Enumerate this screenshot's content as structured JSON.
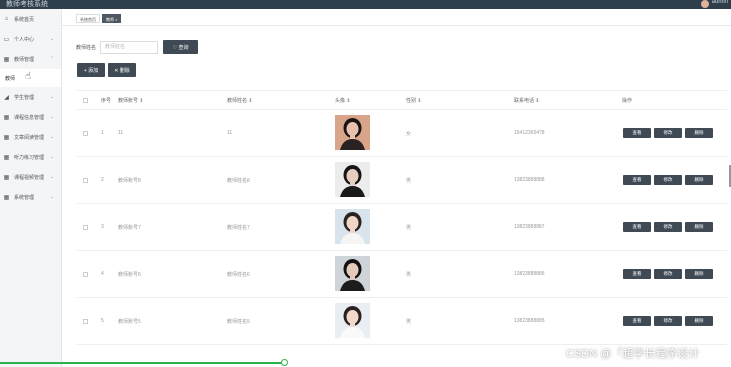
{
  "topbar": {
    "title": "教师考核系统",
    "user": "admin"
  },
  "sidebar": {
    "items": [
      {
        "label": "系统首页",
        "icon": "home-icon",
        "glyph": "⌂"
      },
      {
        "label": "个人中心",
        "icon": "calendar-icon",
        "glyph": "▭"
      },
      {
        "label": "教师管理",
        "icon": "grid-icon",
        "glyph": "▦"
      },
      {
        "label": "学生管理",
        "icon": "trend-icon",
        "glyph": "◢"
      },
      {
        "label": "课程信息管理",
        "icon": "grid-icon",
        "glyph": "▦"
      },
      {
        "label": "文章阅读管理",
        "icon": "grid-icon",
        "glyph": "▦"
      },
      {
        "label": "听力练习管理",
        "icon": "grid-icon",
        "glyph": "▦"
      },
      {
        "label": "课程视频管理",
        "icon": "grid-icon",
        "glyph": "▦"
      },
      {
        "label": "系统管理",
        "icon": "grid-icon",
        "glyph": "▦"
      }
    ],
    "sub_item": "教师"
  },
  "tabs": [
    {
      "label": "系统首页"
    },
    {
      "label": "教师 ×"
    }
  ],
  "search": {
    "label": "教师姓名",
    "placeholder": "教师姓名",
    "button": "♡ 查询"
  },
  "actions": {
    "add": "+ 添加",
    "delete": "✕ 删除"
  },
  "table": {
    "headers": {
      "index": "序号",
      "teacher_no": "教师账号 ⇕",
      "name": "教师姓名 ⇕",
      "avatar": "头像 ⇕",
      "gender": "性别 ⇕",
      "phone": "联系电话 ⇕",
      "ops": "操作"
    },
    "rows": [
      {
        "index": "1",
        "teacher_no": "11",
        "name": "11",
        "gender": "女",
        "phone": "15412365478",
        "photo": "a"
      },
      {
        "index": "2",
        "teacher_no": "教师账号8",
        "name": "教师姓名8",
        "gender": "男",
        "phone": "13823888888",
        "photo": "b"
      },
      {
        "index": "3",
        "teacher_no": "教师账号7",
        "name": "教师姓名7",
        "gender": "男",
        "phone": "13823888887",
        "photo": "c"
      },
      {
        "index": "4",
        "teacher_no": "教师账号6",
        "name": "教师姓名6",
        "gender": "男",
        "phone": "13823888886",
        "photo": "d"
      },
      {
        "index": "5",
        "teacher_no": "教师账号5",
        "name": "教师姓名5",
        "gender": "男",
        "phone": "13823888885",
        "photo": "e"
      }
    ],
    "ops": {
      "view": "查看",
      "edit": "修改",
      "delete": "删除"
    }
  },
  "watermark": "CSDN @「超学长程序设计"
}
